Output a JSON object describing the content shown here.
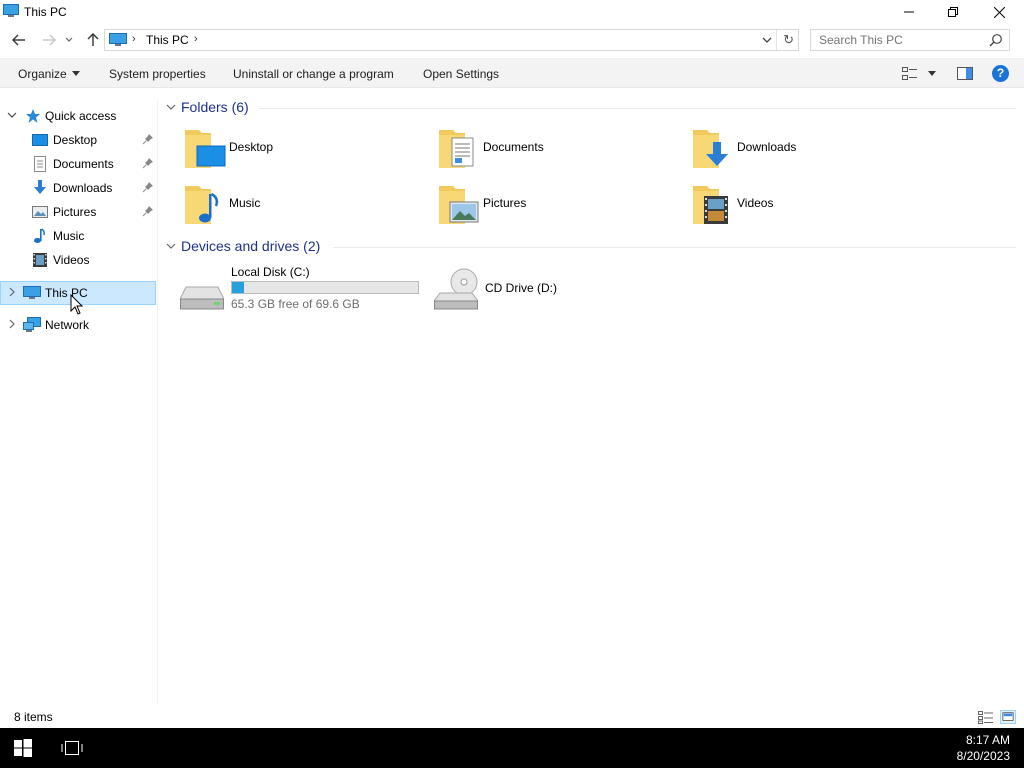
{
  "window": {
    "title": "This PC",
    "minimize_label": "Minimize",
    "restore_label": "Restore",
    "close_label": "Close"
  },
  "address_bar": {
    "breadcrumb": [
      "This PC"
    ],
    "search_placeholder": "Search This PC"
  },
  "command_bar": {
    "organize": "Organize",
    "system_properties": "System properties",
    "uninstall": "Uninstall or change a program",
    "open_settings": "Open Settings",
    "help": "?"
  },
  "nav_pane": {
    "quick_access": "Quick access",
    "quick_items": [
      {
        "label": "Desktop",
        "icon": "desktop-icon",
        "pinned": true
      },
      {
        "label": "Documents",
        "icon": "documents-icon",
        "pinned": true
      },
      {
        "label": "Downloads",
        "icon": "downloads-icon",
        "pinned": true
      },
      {
        "label": "Pictures",
        "icon": "pictures-icon",
        "pinned": true
      },
      {
        "label": "Music",
        "icon": "music-icon",
        "pinned": false
      },
      {
        "label": "Videos",
        "icon": "videos-icon",
        "pinned": false
      }
    ],
    "this_pc": "This PC",
    "network": "Network",
    "selected": "This PC"
  },
  "content": {
    "folders_header": "Folders (6)",
    "folders": [
      {
        "label": "Desktop",
        "icon": "desktop-folder-icon"
      },
      {
        "label": "Documents",
        "icon": "documents-folder-icon"
      },
      {
        "label": "Downloads",
        "icon": "downloads-folder-icon"
      },
      {
        "label": "Music",
        "icon": "music-folder-icon"
      },
      {
        "label": "Pictures",
        "icon": "pictures-folder-icon"
      },
      {
        "label": "Videos",
        "icon": "videos-folder-icon"
      }
    ],
    "drives_header": "Devices and drives (2)",
    "drives": [
      {
        "label": "Local Disk (C:)",
        "free_text": "65.3 GB free of 69.6 GB",
        "used_fraction": 0.062,
        "icon": "hard-drive-icon"
      },
      {
        "label": "CD Drive (D:)",
        "icon": "cd-drive-icon"
      }
    ]
  },
  "status_bar": {
    "item_count": "8 items"
  },
  "taskbar": {
    "time": "8:17 AM",
    "date": "8/20/2023"
  },
  "colors": {
    "accent": "#0078d7",
    "selection": "#cce8ff",
    "section_title": "#1e3287",
    "drive_bar": "#26a0da"
  }
}
